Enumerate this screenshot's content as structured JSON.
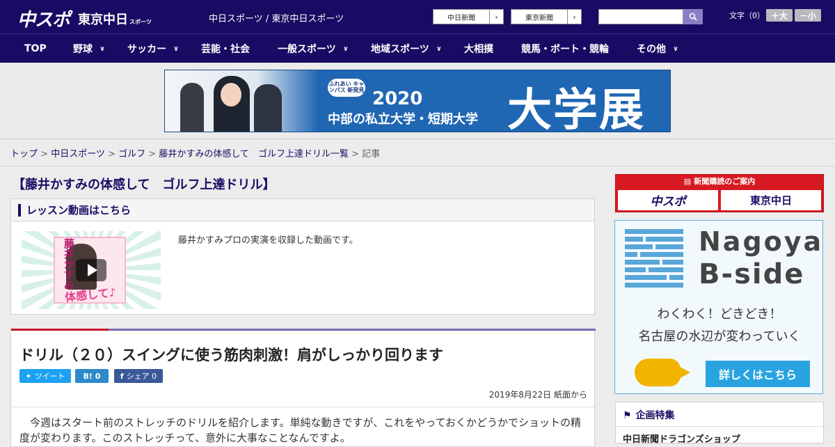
{
  "header": {
    "logo_chunichi": "中スポ",
    "logo_tokyo": "東京中日",
    "logo_tokyo_small": "スポーツ",
    "site_link": "中日スポーツ / 東京中日スポーツ",
    "paper_buttons": [
      "中日新聞",
      "東京新聞"
    ],
    "search": {
      "placeholder": ""
    },
    "font_size_label": "文字（0）",
    "font_larger": "＋大",
    "font_smaller": "－小"
  },
  "nav": {
    "items": [
      {
        "label": "TOP",
        "has_menu": false
      },
      {
        "label": "野球",
        "has_menu": true
      },
      {
        "label": "サッカー",
        "has_menu": true
      },
      {
        "label": "芸能・社会",
        "has_menu": false
      },
      {
        "label": "一般スポーツ",
        "has_menu": true
      },
      {
        "label": "地域スポーツ",
        "has_menu": true
      },
      {
        "label": "大相撲",
        "has_menu": false
      },
      {
        "label": "競馬・ボート・競輪",
        "has_menu": false
      },
      {
        "label": "その他",
        "has_menu": true
      }
    ]
  },
  "banner": {
    "badge": "ふれあい キャンパス 新発見",
    "year": "2020",
    "subtitle": "中部の私立大学・短期大学",
    "big_text": "大学展"
  },
  "breadcrumb": {
    "items": [
      "トップ",
      "中日スポーツ",
      "ゴルフ",
      "藤井かすみの体感して　ゴルフ上達ドリル一覧"
    ],
    "current": "記事",
    "separator": ">"
  },
  "series_title": "【藤井かすみの体感して　ゴルフ上達ドリル】",
  "lesson": {
    "heading": "レッスン動画はこちら",
    "thumb_vertical": "藤井かすみ",
    "thumb_text": "体感して♪",
    "description": "藤井かすみプロの実演を収録した動画です。"
  },
  "article": {
    "title": "ドリル（２０）スイングに使う筋肉刺激！肩がしっかり回ります",
    "share": {
      "tweet": "ツイート",
      "hatena": "B! 0",
      "facebook": "シェア 0"
    },
    "date": "2019年8月22日 紙面から",
    "body": "　今週はスタート前のストレッチのドリルを紹介します。単純な動きですが、これをやっておくかどうかでショットの精度が変わります。このストレッチって、意外に大事なことなんですよ。"
  },
  "sidebar": {
    "subscribe_head": "新聞購読のご案内",
    "subscribe_a": "中スポ",
    "subscribe_b": "東京中日",
    "bside_name_1": "Nagoya",
    "bside_name_2": "B-side",
    "bside_tag_1": "わくわく！どきどき！",
    "bside_tag_2": "名古屋の水辺が変わっていく",
    "bside_cta": "詳しくはこちら",
    "feature_head": "企画特集",
    "feature_item": "中日新聞ドラゴンズショップ"
  },
  "colors": {
    "brand_navy": "#1b0a63",
    "accent_red": "#c8102e",
    "bside_blue": "#29a3e0"
  }
}
